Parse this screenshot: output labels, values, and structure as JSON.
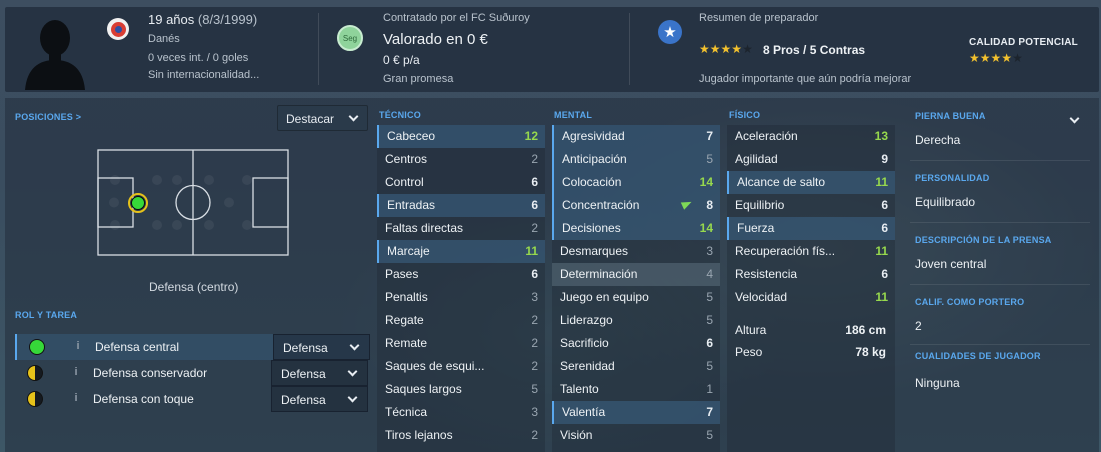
{
  "header": {
    "age": "19 años",
    "dob": "(8/3/1999)",
    "nationality": "Danés",
    "caps": "0 veces int. / 0 goles",
    "intl_status": "Sin internacionalidad...",
    "contract": "Contratado por el FC Suðuroy",
    "contract_badge": "Seg",
    "value": "Valorado en 0 €",
    "wage": "0 € p/a",
    "status": "Gran promesa",
    "scout_title": "Resumen de preparador",
    "pros_cons": "8 Pros / 5 Contras",
    "scout_summary": "Jugador importante que aún podría mejorar",
    "current_stars": 4,
    "potential_label": "CALIDAD POTENCIAL",
    "potential_stars": 4,
    "colors": {
      "star_on": "#f2c12e",
      "star_off": "#1c242d",
      "accent": "#5aa8ee"
    }
  },
  "positions": {
    "title": "POSICIONES >",
    "highlight_btn": "Destacar",
    "position_label": "Defensa (centro)"
  },
  "roles": {
    "title": "ROL Y TAREA",
    "items": [
      {
        "name": "Defensa central",
        "duty": "Defensa",
        "rating": "full"
      },
      {
        "name": "Defensa conservador",
        "duty": "Defensa",
        "rating": "half"
      },
      {
        "name": "Defensa con toque",
        "duty": "Defensa",
        "rating": "half"
      }
    ]
  },
  "technical": {
    "title": "TÉCNICO",
    "items": [
      {
        "name": "Cabeceo",
        "value": "12",
        "style": "green",
        "hl": "hl"
      },
      {
        "name": "Centros",
        "value": "2",
        "style": "gray",
        "hl": ""
      },
      {
        "name": "Control",
        "value": "6",
        "style": "",
        "hl": ""
      },
      {
        "name": "Entradas",
        "value": "6",
        "style": "",
        "hl": "hl"
      },
      {
        "name": "Faltas directas",
        "value": "2",
        "style": "gray",
        "hl": ""
      },
      {
        "name": "Marcaje",
        "value": "11",
        "style": "green",
        "hl": "hl"
      },
      {
        "name": "Pases",
        "value": "6",
        "style": "",
        "hl": ""
      },
      {
        "name": "Penaltis",
        "value": "3",
        "style": "gray",
        "hl": ""
      },
      {
        "name": "Regate",
        "value": "2",
        "style": "gray",
        "hl": ""
      },
      {
        "name": "Remate",
        "value": "2",
        "style": "gray",
        "hl": ""
      },
      {
        "name": "Saques de esqui...",
        "value": "2",
        "style": "gray",
        "hl": ""
      },
      {
        "name": "Saques largos",
        "value": "5",
        "style": "gray",
        "hl": ""
      },
      {
        "name": "Técnica",
        "value": "3",
        "style": "gray",
        "hl": ""
      },
      {
        "name": "Tiros lejanos",
        "value": "2",
        "style": "gray",
        "hl": ""
      }
    ]
  },
  "mental": {
    "title": "MENTAL",
    "items": [
      {
        "name": "Agresividad",
        "value": "7",
        "style": "",
        "hl": "hl"
      },
      {
        "name": "Anticipación",
        "value": "5",
        "style": "gray",
        "hl": "hl"
      },
      {
        "name": "Colocación",
        "value": "14",
        "style": "green",
        "hl": "hl"
      },
      {
        "name": "Concentración",
        "value": "8",
        "style": "",
        "hl": "hl"
      },
      {
        "name": "Decisiones",
        "value": "14",
        "style": "green",
        "hl": "hl"
      },
      {
        "name": "Desmarques",
        "value": "3",
        "style": "gray",
        "hl": ""
      },
      {
        "name": "Determinación",
        "value": "4",
        "style": "gray",
        "hl": "hl2"
      },
      {
        "name": "Juego en equipo",
        "value": "5",
        "style": "gray",
        "hl": ""
      },
      {
        "name": "Liderazgo",
        "value": "5",
        "style": "gray",
        "hl": ""
      },
      {
        "name": "Sacrificio",
        "value": "6",
        "style": "",
        "hl": ""
      },
      {
        "name": "Serenidad",
        "value": "5",
        "style": "gray",
        "hl": ""
      },
      {
        "name": "Talento",
        "value": "1",
        "style": "gray",
        "hl": ""
      },
      {
        "name": "Valentía",
        "value": "7",
        "style": "",
        "hl": "hl"
      },
      {
        "name": "Visión",
        "value": "5",
        "style": "gray",
        "hl": ""
      }
    ]
  },
  "physical": {
    "title": "FÍSICO",
    "items": [
      {
        "name": "Aceleración",
        "value": "13",
        "style": "green",
        "hl": ""
      },
      {
        "name": "Agilidad",
        "value": "9",
        "style": "",
        "hl": ""
      },
      {
        "name": "Alcance de salto",
        "value": "11",
        "style": "green",
        "hl": "hl"
      },
      {
        "name": "Equilibrio",
        "value": "6",
        "style": "",
        "hl": ""
      },
      {
        "name": "Fuerza",
        "value": "6",
        "style": "",
        "hl": "hl"
      },
      {
        "name": "Recuperación fís...",
        "value": "11",
        "style": "green",
        "hl": ""
      },
      {
        "name": "Resistencia",
        "value": "6",
        "style": "",
        "hl": ""
      },
      {
        "name": "Velocidad",
        "value": "11",
        "style": "green",
        "hl": ""
      }
    ],
    "height_label": "Altura",
    "height_value": "186 cm",
    "weight_label": "Peso",
    "weight_value": "78 kg"
  },
  "details": {
    "foot_title": "PIERNA BUENA",
    "foot_value": "Derecha",
    "personality_title": "PERSONALIDAD",
    "personality_value": "Equilibrado",
    "media_title": "DESCRIPCIÓN DE LA PRENSA",
    "media_value": "Joven central",
    "gk_title": "CALIF. COMO PORTERO",
    "gk_value": "2",
    "traits_title": "CUALIDADES DE JUGADOR",
    "traits_value": "Ninguna"
  }
}
